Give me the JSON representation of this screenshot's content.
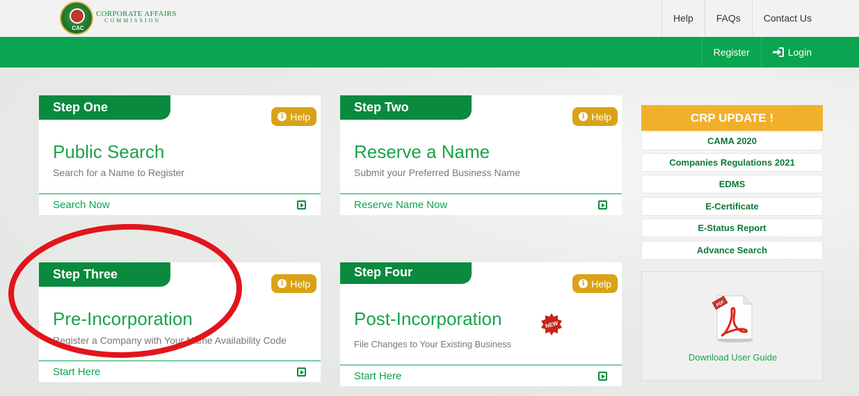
{
  "header": {
    "logo": {
      "seal_text": "CAC",
      "title": "CORPORATE AFFAIRS",
      "subtitle": "COMMISSION"
    },
    "nav": [
      {
        "label": "Help"
      },
      {
        "label": "FAQs"
      },
      {
        "label": "Contact Us"
      }
    ]
  },
  "greenbar": {
    "register_label": "Register",
    "login_label": "Login",
    "login_icon": "sign-in-icon"
  },
  "cards": [
    {
      "step": "Step One",
      "help": "Help",
      "title": "Public Search",
      "subtitle": "Search for a Name to Register",
      "action": "Search Now",
      "action_icon": "play-square-icon"
    },
    {
      "step": "Step Two",
      "help": "Help",
      "title": "Reserve a Name",
      "subtitle": "Submit your Preferred Business Name",
      "action": "Reserve Name Now",
      "action_icon": "play-square-icon"
    },
    {
      "step": "Step Three",
      "help": "Help",
      "title": "Pre-Incorporation",
      "subtitle": "Register a Company with Your Name Availability Code",
      "action": "Start Here",
      "action_icon": "play-square-icon"
    },
    {
      "step": "Step Four",
      "help": "Help",
      "title": "Post-Incorporation",
      "subtitle": "File Changes to Your Existing Business",
      "action": "Start Here",
      "action_icon": "play-square-icon",
      "badge": "NEW"
    }
  ],
  "sidebar": {
    "heading": "CRP UPDATE !",
    "links": [
      {
        "label": "CAMA 2020"
      },
      {
        "label": "Companies Regulations 2021"
      },
      {
        "label": "EDMS"
      },
      {
        "label": "E-Certificate"
      },
      {
        "label": "E-Status Report"
      },
      {
        "label": "Advance Search"
      }
    ],
    "guide": {
      "icon": "pdf-icon",
      "icon_label": "PDF",
      "label": "Download User Guide"
    }
  },
  "colors": {
    "brand_green": "#0ba450",
    "tab_green": "#0a8a3e",
    "help_gold": "#d9a318",
    "crp_orange": "#f1b02c",
    "annotation_red": "#e3141c"
  }
}
